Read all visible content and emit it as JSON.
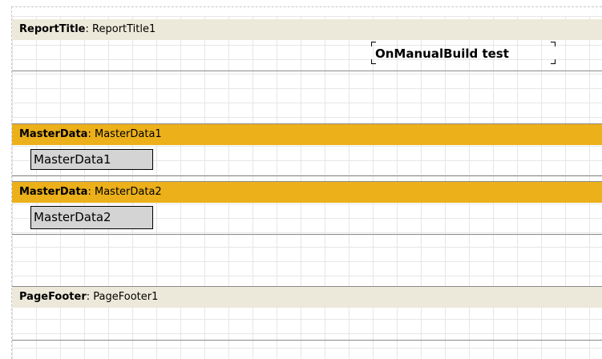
{
  "bands": {
    "report_title": {
      "type": "ReportTitle",
      "name": "ReportTitle1",
      "memo_text": "OnManualBuild test"
    },
    "master_data_1": {
      "type": "MasterData",
      "name": "MasterData1",
      "memo_text": "MasterData1"
    },
    "master_data_2": {
      "type": "MasterData",
      "name": "MasterData2",
      "memo_text": "MasterData2"
    },
    "page_footer": {
      "type": "PageFooter",
      "name": "PageFooter1"
    }
  },
  "separator": ":",
  "colors": {
    "title_band_header": "#ede9da",
    "data_band_header": "#ebb01a",
    "memo_fill": "#d4d4d4",
    "grid_line": "#e6e6e6",
    "band_border": "#8a8a8a"
  }
}
